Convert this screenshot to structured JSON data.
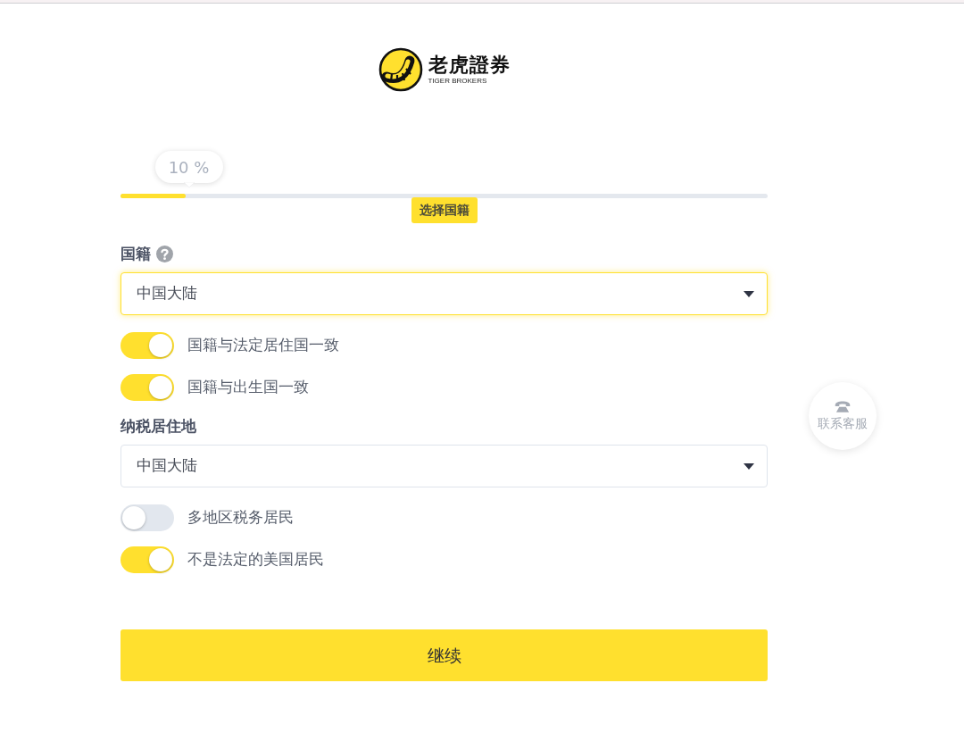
{
  "logo": {
    "name": "老虎證券",
    "subtitle": "TIGER BROKERS"
  },
  "progress": {
    "reading": "10 %",
    "level": 0.1,
    "step": "选择国籍"
  },
  "fields": [
    {
      "label": "国籍",
      "help": true,
      "value": "中国大陆",
      "focused": true,
      "toggles": [
        {
          "label": "国籍与法定居住国一致",
          "on": true
        },
        {
          "label": "国籍与出生国一致",
          "on": true
        }
      ]
    },
    {
      "label": "纳税居住地",
      "help": false,
      "value": "中国大陆",
      "focused": false,
      "toggles": [
        {
          "label": "多地区税务居民",
          "on": false
        },
        {
          "label": "不是法定的美国居民",
          "on": true
        }
      ]
    }
  ],
  "submit": {
    "label": "继续"
  },
  "contact": {
    "label": "联系客服"
  }
}
